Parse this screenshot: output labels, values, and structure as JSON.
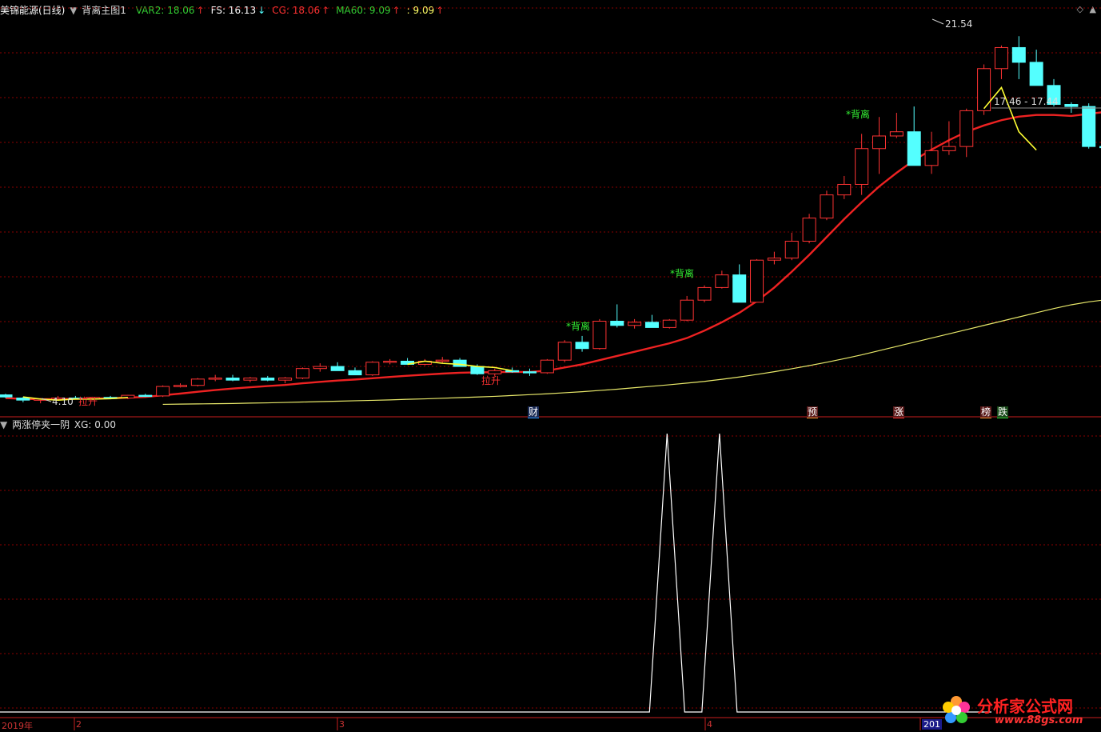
{
  "header": {
    "stock_name": "美锦能源(日线)",
    "indicator_name": "背离主图1",
    "values": [
      {
        "label": "VAR2: 18.06",
        "arrow": "↑",
        "color": "#33cc33"
      },
      {
        "label": "FS: 16.13",
        "arrow": "↓",
        "color": "#ffffff"
      },
      {
        "label": "CG: 18.06",
        "arrow": "↑",
        "color": "#ff3333"
      },
      {
        "label": "MA60: 9.09",
        "arrow": "↑",
        "color": "#33cc33"
      },
      {
        "label": ": 9.09",
        "arrow": "↑",
        "color": "#ffff66"
      }
    ]
  },
  "sub_header": {
    "indicator_name": "两涨停夹一阴",
    "value_label": "XG: 0.00"
  },
  "annotations": {
    "high_label": "21.54",
    "low_label": "4.10",
    "last_label": "17.46 - 17.44",
    "divergence": "*背离",
    "pull_up": "拉升"
  },
  "event_tags": [
    {
      "text": "财",
      "color": "#3399ff"
    },
    {
      "text": "预",
      "color": "#ff9933"
    },
    {
      "text": "涨",
      "color": "#ff3333"
    },
    {
      "text": "榜",
      "color": "#ff9933"
    },
    {
      "text": "跌",
      "color": "#33cc33"
    }
  ],
  "x_axis": {
    "labels": [
      "2019年",
      "2",
      "3",
      "4",
      "201"
    ]
  },
  "logo": {
    "text": "分析家公式网",
    "url": "www.88gs.com"
  },
  "colors": {
    "up": "#ff3333",
    "down": "#54ffff",
    "cg_line": "#ee2222",
    "ma60_line": "#e8e86a",
    "grid": "#8b0000"
  },
  "chart_data": {
    "type": "candlestick",
    "ohlc": [
      [
        4.5,
        4.55,
        4.35,
        4.4
      ],
      [
        4.35,
        4.4,
        4.15,
        4.25
      ],
      [
        4.25,
        4.35,
        4.1,
        4.3
      ],
      [
        4.3,
        4.45,
        4.25,
        4.35
      ],
      [
        4.35,
        4.45,
        4.28,
        4.32
      ],
      [
        4.32,
        4.4,
        4.25,
        4.38
      ],
      [
        4.38,
        4.45,
        4.3,
        4.35
      ],
      [
        4.35,
        4.5,
        4.3,
        4.48
      ],
      [
        4.48,
        4.55,
        4.4,
        4.45
      ],
      [
        4.45,
        4.95,
        4.4,
        4.9
      ],
      [
        4.9,
        5.05,
        4.85,
        4.95
      ],
      [
        4.95,
        5.3,
        4.9,
        5.25
      ],
      [
        5.25,
        5.45,
        5.15,
        5.3
      ],
      [
        5.3,
        5.45,
        5.15,
        5.2
      ],
      [
        5.2,
        5.35,
        5.1,
        5.3
      ],
      [
        5.3,
        5.4,
        5.15,
        5.2
      ],
      [
        5.2,
        5.35,
        5.05,
        5.3
      ],
      [
        5.3,
        5.8,
        5.25,
        5.75
      ],
      [
        5.75,
        6.0,
        5.6,
        5.85
      ],
      [
        5.85,
        6.05,
        5.7,
        5.65
      ],
      [
        5.65,
        5.8,
        5.5,
        5.45
      ],
      [
        5.45,
        6.1,
        5.4,
        6.05
      ],
      [
        6.05,
        6.2,
        5.95,
        6.1
      ],
      [
        6.1,
        6.25,
        5.95,
        5.95
      ],
      [
        5.95,
        6.2,
        5.9,
        6.1
      ],
      [
        6.1,
        6.3,
        6.0,
        6.15
      ],
      [
        6.15,
        6.25,
        5.85,
        5.85
      ],
      [
        5.85,
        5.95,
        5.45,
        5.5
      ],
      [
        5.5,
        5.75,
        5.4,
        5.65
      ],
      [
        5.65,
        5.8,
        5.55,
        5.6
      ],
      [
        5.6,
        5.75,
        5.4,
        5.55
      ],
      [
        5.55,
        6.2,
        5.5,
        6.15
      ],
      [
        6.15,
        7.1,
        6.05,
        7.0
      ],
      [
        7.0,
        7.3,
        6.55,
        6.7
      ],
      [
        6.7,
        8.1,
        6.65,
        8.0
      ],
      [
        8.0,
        8.8,
        7.7,
        7.8
      ],
      [
        7.8,
        8.1,
        7.65,
        7.95
      ],
      [
        7.95,
        8.3,
        7.75,
        7.7
      ],
      [
        7.7,
        8.1,
        7.65,
        8.05
      ],
      [
        8.05,
        9.2,
        8.0,
        9.0
      ],
      [
        9.0,
        9.7,
        8.9,
        9.6
      ],
      [
        9.6,
        10.4,
        9.55,
        10.2
      ],
      [
        10.2,
        10.7,
        8.9,
        8.9
      ],
      [
        8.9,
        10.95,
        8.9,
        10.9
      ],
      [
        10.9,
        11.3,
        10.7,
        11.0
      ],
      [
        11.0,
        12.2,
        10.9,
        11.8
      ],
      [
        11.8,
        13.1,
        11.7,
        12.9
      ],
      [
        12.9,
        14.2,
        12.8,
        14.0
      ],
      [
        14.0,
        14.9,
        13.8,
        14.5
      ],
      [
        14.5,
        16.9,
        14.0,
        16.2
      ],
      [
        16.2,
        17.7,
        15.0,
        16.8
      ],
      [
        16.8,
        17.9,
        16.7,
        17.0
      ],
      [
        17.0,
        18.2,
        15.4,
        15.4
      ],
      [
        15.4,
        17.0,
        15.0,
        16.1
      ],
      [
        16.1,
        17.5,
        15.9,
        16.3
      ],
      [
        16.3,
        18.1,
        15.8,
        18.0
      ],
      [
        18.0,
        20.2,
        17.8,
        20.0
      ],
      [
        20.0,
        21.1,
        19.5,
        21.0
      ],
      [
        21.0,
        21.54,
        19.5,
        20.3
      ],
      [
        20.3,
        20.9,
        19.2,
        19.2
      ],
      [
        19.2,
        19.5,
        18.2,
        18.3
      ],
      [
        18.3,
        18.4,
        17.9,
        18.2
      ],
      [
        18.2,
        18.35,
        16.2,
        16.3
      ],
      [
        16.3,
        16.4,
        15.7,
        16.25
      ],
      [
        16.25,
        16.8,
        15.95,
        16.55
      ]
    ],
    "cg_line": [
      4.35,
      4.31,
      4.29,
      4.3,
      4.31,
      4.33,
      4.34,
      4.37,
      4.4,
      4.48,
      4.56,
      4.65,
      4.73,
      4.8,
      4.86,
      4.92,
      4.97,
      5.05,
      5.12,
      5.18,
      5.23,
      5.29,
      5.35,
      5.41,
      5.46,
      5.51,
      5.55,
      5.57,
      5.58,
      5.59,
      5.59,
      5.65,
      5.8,
      5.95,
      6.15,
      6.35,
      6.55,
      6.75,
      6.95,
      7.2,
      7.55,
      7.95,
      8.4,
      8.95,
      9.6,
      10.35,
      11.15,
      12.0,
      12.85,
      13.65,
      14.4,
      15.05,
      15.65,
      16.15,
      16.6,
      17.0,
      17.3,
      17.55,
      17.72,
      17.8,
      17.8,
      17.75,
      17.85,
      17.95,
      18.06
    ],
    "ma60_line": [
      null,
      null,
      null,
      null,
      null,
      null,
      null,
      null,
      null,
      4.05,
      4.06,
      4.07,
      4.08,
      4.09,
      4.11,
      4.12,
      4.14,
      4.16,
      4.18,
      4.2,
      4.22,
      4.24,
      4.26,
      4.29,
      4.31,
      4.34,
      4.37,
      4.4,
      4.43,
      4.47,
      4.51,
      4.55,
      4.6,
      4.65,
      4.71,
      4.77,
      4.84,
      4.91,
      4.98,
      5.06,
      5.14,
      5.24,
      5.35,
      5.47,
      5.6,
      5.74,
      5.89,
      6.05,
      6.22,
      6.4,
      6.6,
      6.8,
      7.0,
      7.2,
      7.4,
      7.6,
      7.8,
      8.0,
      8.2,
      8.4,
      8.6,
      8.78,
      8.92,
      9.02,
      9.09
    ],
    "fs_line": [
      [
        1,
        4.4
      ],
      [
        2,
        4.3
      ],
      [
        3,
        4.25
      ],
      [
        4,
        4.3
      ],
      [
        5,
        4.3
      ],
      [
        6,
        4.32
      ],
      [
        7,
        4.38
      ],
      [
        23,
        5.95
      ],
      [
        24,
        6.1
      ],
      [
        25,
        6.0
      ],
      [
        26,
        5.95
      ],
      [
        27,
        5.85
      ],
      [
        28,
        5.8
      ],
      [
        29,
        5.65
      ],
      [
        56,
        18.1
      ],
      [
        57,
        19.1
      ],
      [
        58,
        17.0
      ],
      [
        59,
        16.13
      ]
    ],
    "xg_pulses": [
      38,
      41
    ],
    "price_range": [
      3.8,
      22.5
    ],
    "title": "美锦能源(日线)"
  }
}
